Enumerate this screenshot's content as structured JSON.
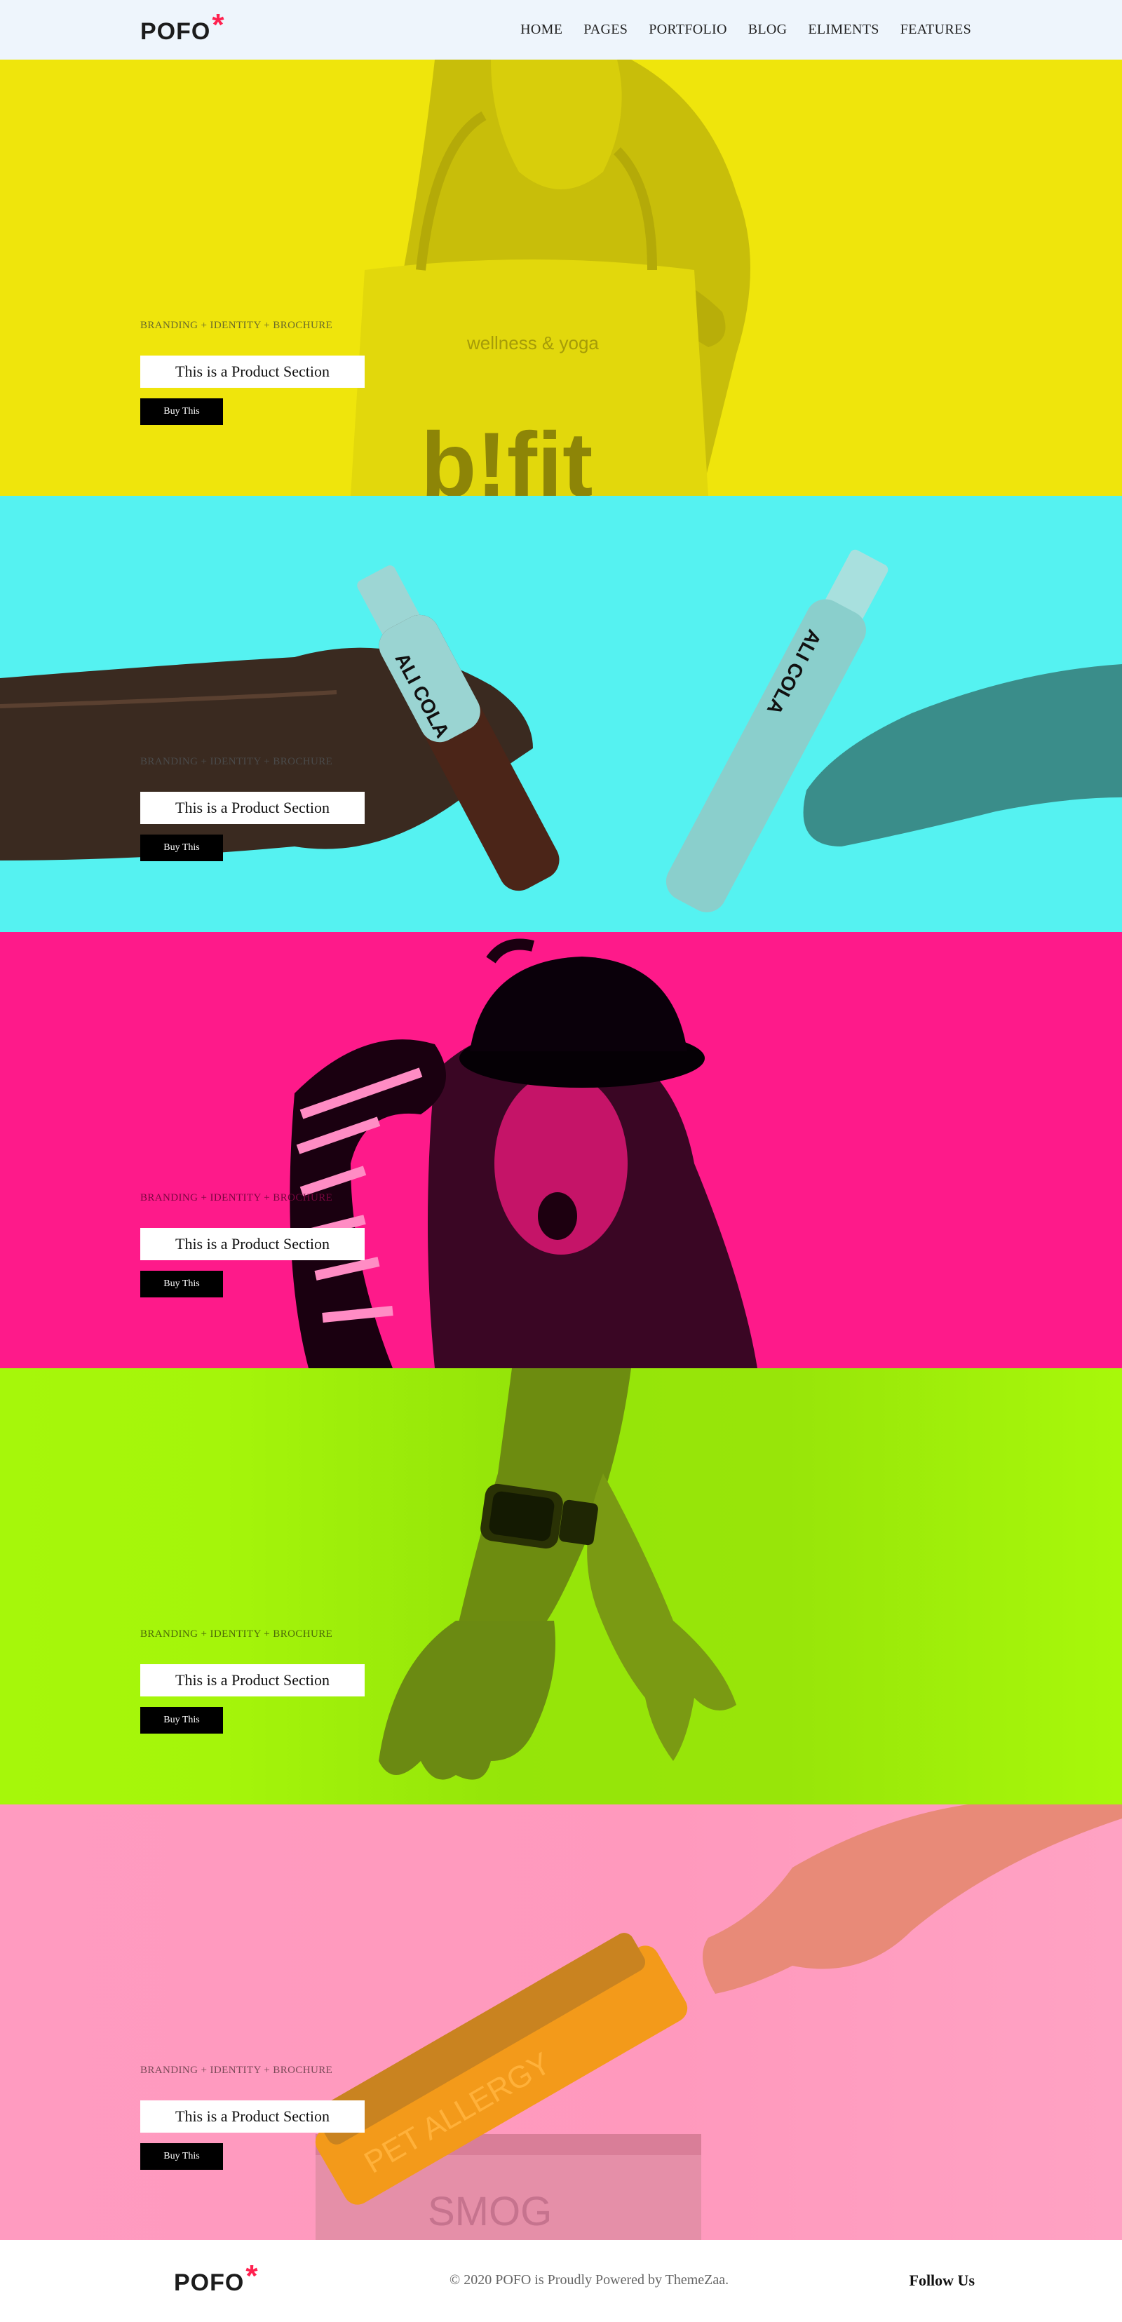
{
  "header": {
    "logo_text": "POFO",
    "logo_mark": "*",
    "nav": [
      "HOME",
      "PAGES",
      "PORTFOLIO",
      "BLOG",
      "ELIMENTS",
      "FEATURES"
    ]
  },
  "sections": [
    {
      "caption": "BRANDING + IDENTITY + BROCHURE",
      "title": "This is a Product Section",
      "button": "Buy This",
      "background": "#efe50c",
      "image": "woman-with-tote-bag",
      "image_text": [
        "wellness & yoga",
        "b!fit"
      ]
    },
    {
      "caption": "BRANDING + IDENTITY + BROCHURE",
      "title": "This is a Product Section",
      "button": "Buy This",
      "background": "#55f2f1",
      "image": "hands-clinking-bottles",
      "image_text": [
        "ALI COLA",
        "ALI COLA"
      ]
    },
    {
      "caption": "BRANDING + IDENTITY + BROCHURE",
      "title": "This is a Product Section",
      "button": "Buy This",
      "background": "#fe1a8a",
      "image": "woman-in-bowler-hat",
      "image_text": []
    },
    {
      "caption": "BRANDING + IDENTITY + BROCHURE",
      "title": "This is a Product Section",
      "button": "Buy This",
      "background": "#a6f70a",
      "image": "arm-with-smartwatch",
      "image_text": []
    },
    {
      "caption": "BRANDING + IDENTITY + BROCHURE",
      "title": "This is a Product Section",
      "button": "Buy This",
      "background": "#ff9bc0",
      "image": "hand-with-air-purifier",
      "image_text": [
        "PET ALLERGY",
        "SMOG"
      ]
    }
  ],
  "footer": {
    "logo_text": "POFO",
    "logo_mark": "*",
    "copyright": "© 2020 POFO is Proudly Powered by ThemeZaa.",
    "follow": "Follow Us"
  }
}
